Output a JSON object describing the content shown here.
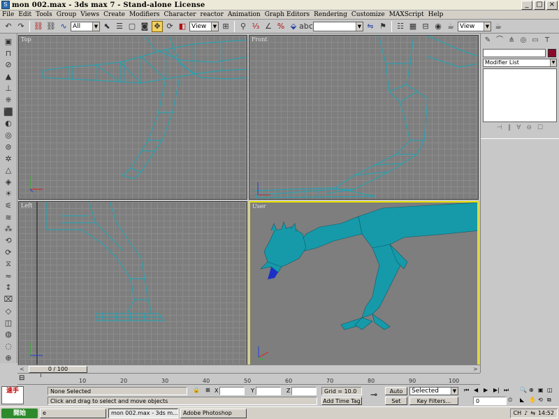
{
  "window": {
    "title": "mon 002.max - 3ds max 7 - Stand-alone License",
    "minimize": "_",
    "maximize": "□",
    "close": "×"
  },
  "menu": [
    "File",
    "Edit",
    "Tools",
    "Group",
    "Views",
    "Create",
    "Modifiers",
    "Character",
    "reactor",
    "Animation",
    "Graph Editors",
    "Rendering",
    "Customize",
    "MAXScript",
    "Help"
  ],
  "toolbar": {
    "selection_filter": "All",
    "reference_coord": "View",
    "named_selection": "",
    "render_view": "View"
  },
  "viewports": {
    "top_label": "Top",
    "front_label": "Front",
    "left_label": "Left",
    "user_label": "User",
    "wire_color": "#1aa7b8",
    "shaded_color": "#169aaa",
    "active_border": "#e8e000"
  },
  "command_panel": {
    "modifier_list": "Modifier List"
  },
  "time_slider": {
    "position": "0 / 100",
    "prev": "<",
    "next": ">"
  },
  "trackbar": {
    "ticks": [
      "10",
      "20",
      "30",
      "40",
      "50",
      "60",
      "70",
      "80",
      "90",
      "100"
    ]
  },
  "status": {
    "maxscript_label": "速手",
    "selection": "None Selected",
    "prompt": "Click and drag to select and move objects",
    "x_label": "X",
    "y_label": "Y",
    "z_label": "Z",
    "grid": "Grid = 10.0",
    "add_time_tag": "Add Time Tag",
    "auto_key": "Auto Key",
    "set_key": "Set Key",
    "key_mode": "Selected",
    "key_filters": "Key Filters...",
    "frame": "0"
  },
  "taskbar": {
    "start": "開始",
    "tasks": [
      "e",
      "mon 002.max - 3ds m...",
      "Adobe Photoshop"
    ],
    "lang": "CH",
    "time": "14:52"
  }
}
